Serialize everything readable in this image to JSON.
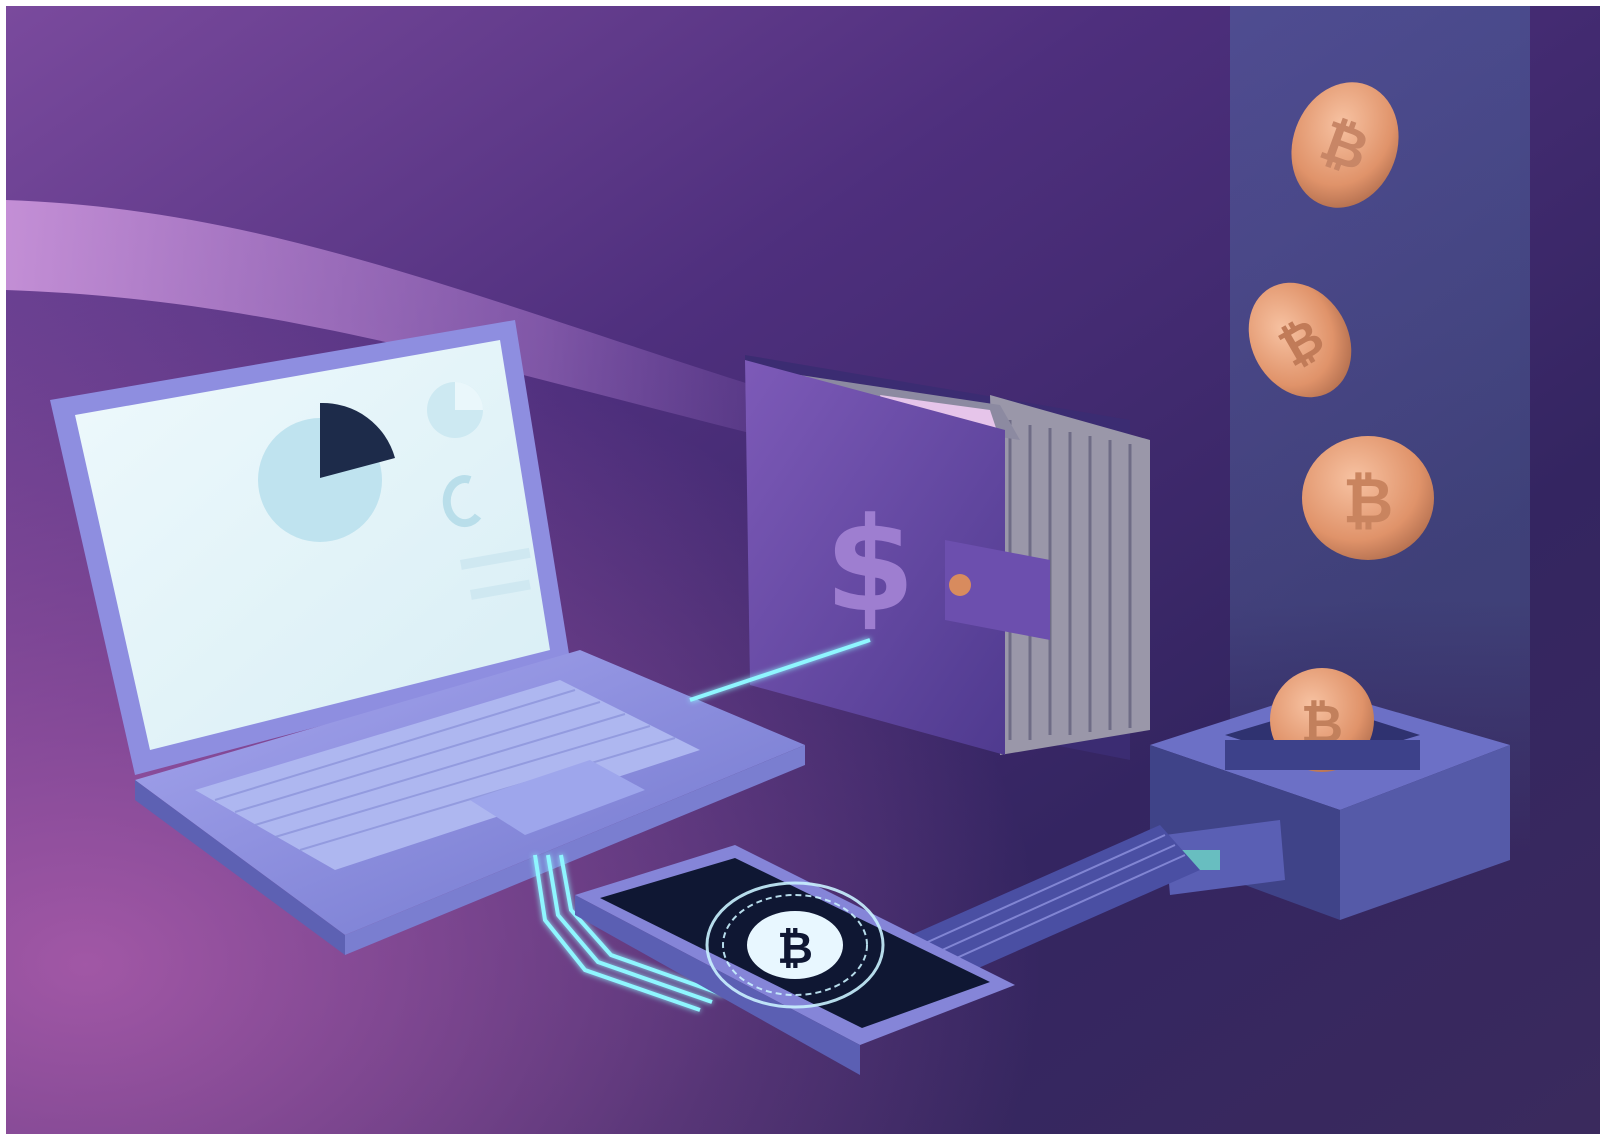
{
  "scene": {
    "palette": {
      "background_top": "#6b3f8e",
      "background_mid": "#3a2a6b",
      "background_bottom": "#2a2050",
      "light_streak": "#c58fd6",
      "neon_cyan": "#7ff3ff",
      "laptop_body": "#8f8fe0",
      "laptop_screen": "#eaf7fb",
      "wallet": "#6a4aa6",
      "coin": "#e0936a",
      "box": "#4b4f9e"
    },
    "icons": {
      "wallet_symbol": "$",
      "coin_symbol": "₿"
    }
  }
}
